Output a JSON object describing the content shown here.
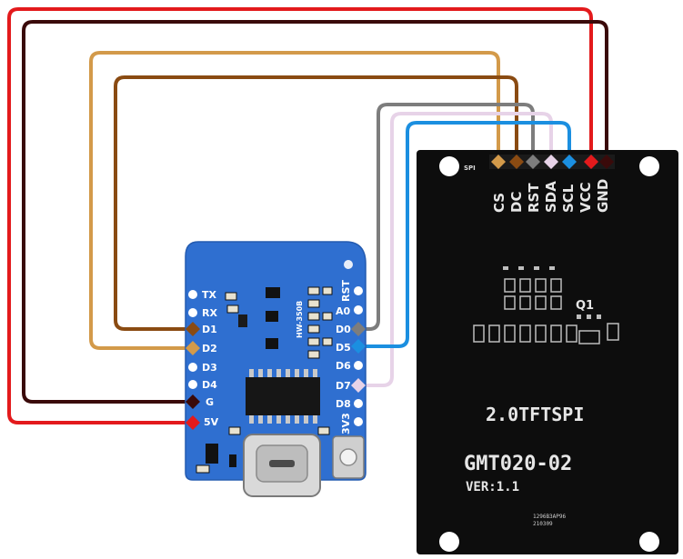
{
  "tft": {
    "silk_spi": "SPI",
    "pins": [
      {
        "label": "CS",
        "color": "#d39a4a"
      },
      {
        "label": "DC",
        "color": "#8a4b12"
      },
      {
        "label": "RST",
        "color": "#7d7d7d"
      },
      {
        "label": "SDA",
        "color": "#e7d3e8"
      },
      {
        "label": "SCL",
        "color": "#1b8fe0"
      },
      {
        "label": "VCC",
        "color": "#e31a1c"
      },
      {
        "label": "GND",
        "color": "#3a0a0a"
      }
    ],
    "chip_label": "Q1",
    "title": "2.0TFTSPI",
    "model": "GMT020-02",
    "version": "VER:1.1",
    "small_code_1": "1296B3AP96",
    "small_code_2": "210309"
  },
  "d1mini": {
    "chip_label": "HW-350B",
    "left_pins": [
      "TX",
      "RX",
      "D1",
      "D2",
      "D3",
      "D4",
      "G",
      "5V"
    ],
    "right_pins": [
      "RST",
      "A0",
      "D0",
      "D5",
      "D6",
      "D7",
      "D8",
      "3V3"
    ]
  },
  "wires": [
    {
      "from": "CS",
      "to": "D2",
      "color": "#d39a4a"
    },
    {
      "from": "DC",
      "to": "D1",
      "color": "#8a4b12"
    },
    {
      "from": "RST",
      "to": "D0",
      "color": "#7d7d7d"
    },
    {
      "from": "SDA",
      "to": "D7",
      "color": "#e7d3e8"
    },
    {
      "from": "SCL",
      "to": "D5",
      "color": "#1b8fe0"
    },
    {
      "from": "VCC",
      "to": "5V",
      "color": "#e31a1c"
    },
    {
      "from": "GND",
      "to": "G",
      "color": "#3a0a0a"
    }
  ]
}
